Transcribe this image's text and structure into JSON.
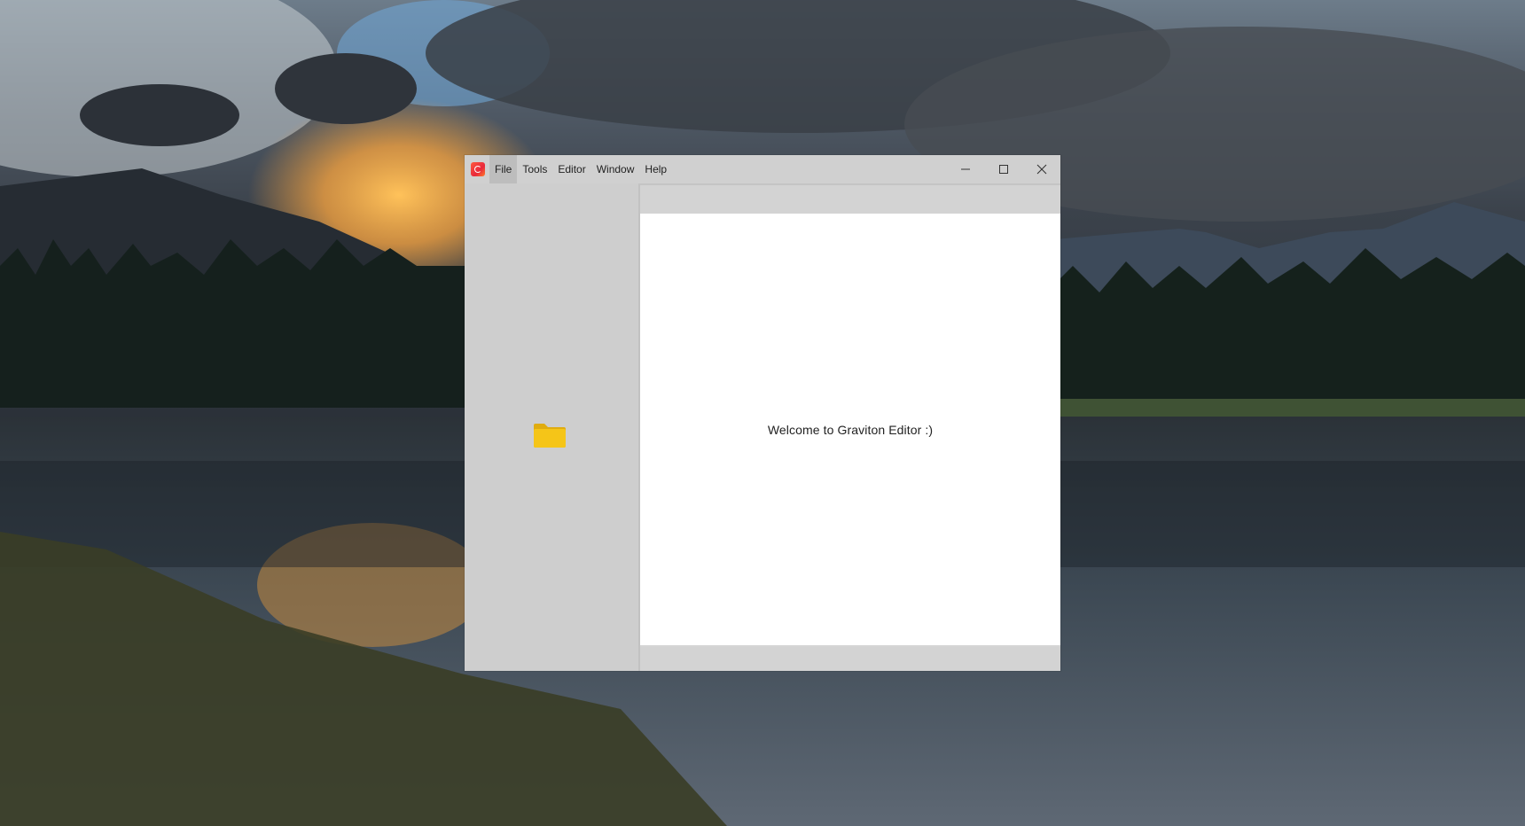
{
  "window": {
    "app_icon": "graviton-logo-icon",
    "menu": [
      {
        "label": "File",
        "active": true
      },
      {
        "label": "Tools",
        "active": false
      },
      {
        "label": "Editor",
        "active": false
      },
      {
        "label": "Window",
        "active": false
      },
      {
        "label": "Help",
        "active": false
      }
    ],
    "controls": [
      "minimize-icon",
      "maximize-icon",
      "close-icon"
    ]
  },
  "sidepanel": {
    "icon": "folder-icon",
    "icon_color": "#f5c518"
  },
  "editor": {
    "welcome_text": "Welcome to Graviton Editor :)"
  },
  "colors": {
    "window_bg": "#cfcfcf",
    "editor_bg": "#ffffff",
    "menu_active": "#bdbdbd"
  }
}
